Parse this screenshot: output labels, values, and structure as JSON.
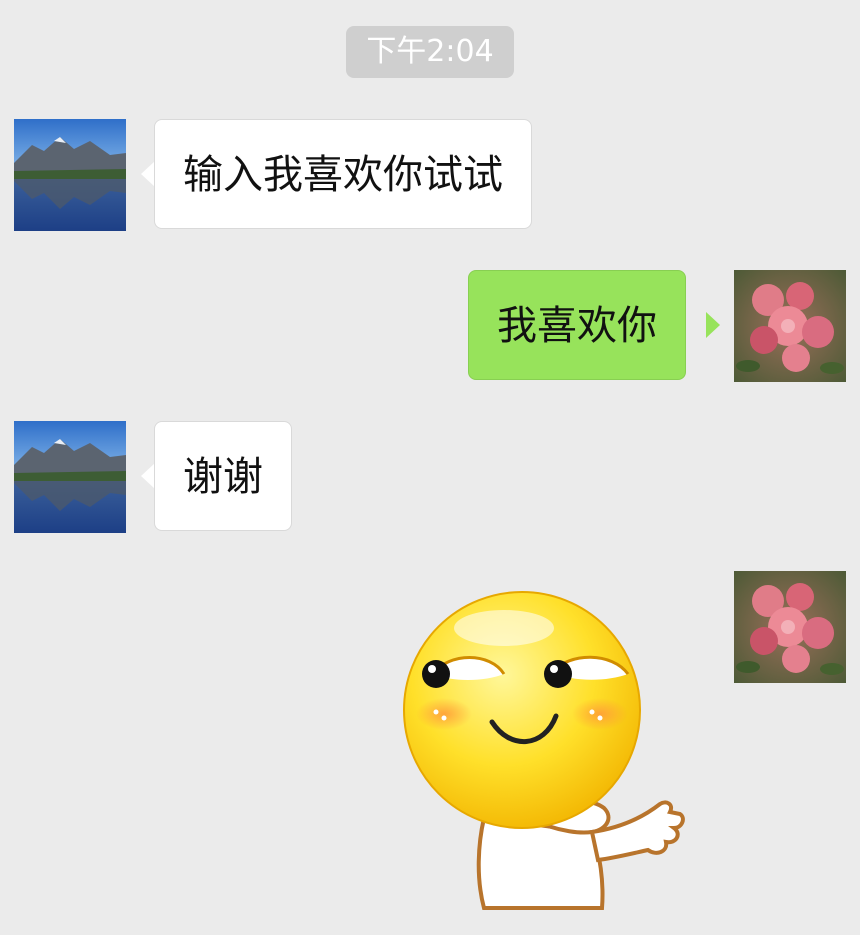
{
  "chat": {
    "timestamp": "下午2:04",
    "messages": [
      {
        "side": "incoming",
        "text": "输入我喜欢你试试",
        "avatar": "mountain-lake-avatar"
      },
      {
        "side": "outgoing",
        "text": "我喜欢你",
        "avatar": "pink-flowers-avatar"
      },
      {
        "side": "incoming",
        "text": "谢谢",
        "avatar": "mountain-lake-avatar"
      },
      {
        "side": "outgoing",
        "sticker": "smirking-smiley-sticker",
        "avatar": "pink-flowers-avatar"
      }
    ]
  },
  "colors": {
    "background": "#ebebeb",
    "incoming_bubble": "#ffffff",
    "outgoing_bubble": "#97e35b",
    "timestamp_chip": "#cfcfcf"
  }
}
